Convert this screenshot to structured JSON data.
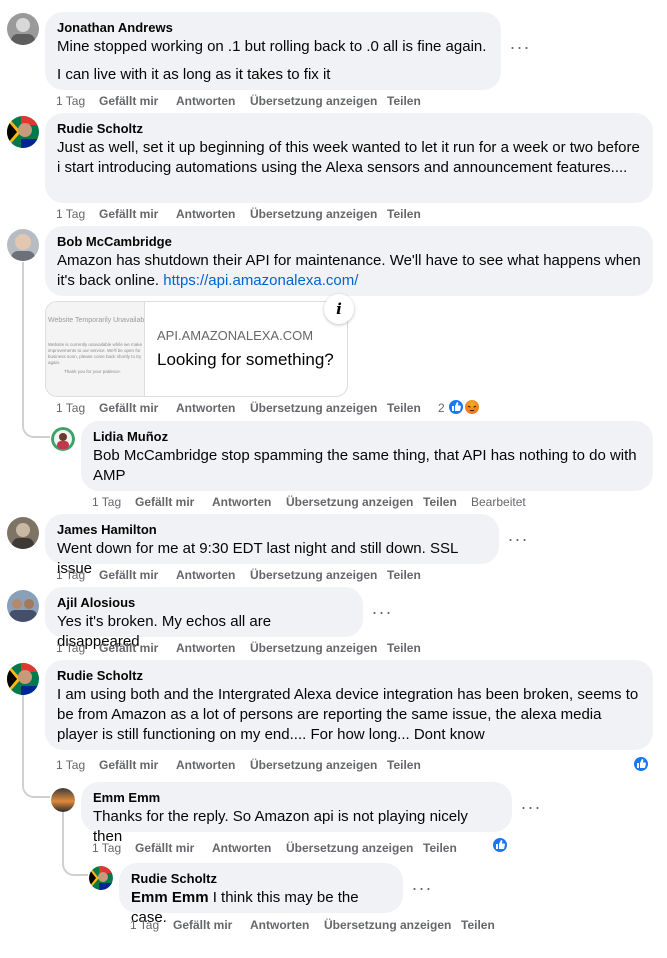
{
  "action_labels": {
    "like": "Gefällt mir",
    "reply": "Antworten",
    "translate": "Übersetzung anzeigen",
    "share": "Teilen",
    "edited": "Bearbeitet"
  },
  "colors": {
    "bubble": "#f0f2f5",
    "secondary_text": "#65676b",
    "link": "#0064d1",
    "like_blue": "#1877f2"
  },
  "comments": [
    {
      "author": "Jonathan Andrews",
      "lines": [
        "Mine stopped working on .1 but rolling back to .0 all is fine again.",
        "I can live with it as long as it takes to fix it"
      ],
      "time": "1 Tag"
    },
    {
      "author": "Rudie Scholtz",
      "text": "Just as well, set it up beginning of this week wanted to let it run for a week or two before i start introducing automations using the Alexa sensors and announcement features....",
      "time": "1 Tag"
    },
    {
      "author": "Bob McCambridge",
      "text": "Amazon has shutdown their API for maintenance. We'll have to see what happens when it's back online.",
      "link_text": "https://api.amazonalexa.com/",
      "time": "1 Tag",
      "reaction_count": "2",
      "reactions": [
        "like",
        "angry"
      ],
      "link_preview": {
        "domain": "API.AMAZONALEXA.COM",
        "title": "Looking for something?",
        "thumb_heading": "Website Temporarily Unavailable",
        "thumb_body": "Website is currently unavailable while we make improvements to our service. We'll be open for business soon, please come back shortly to try again.",
        "thumb_thanks": "Thank you for your patience.",
        "info_icon": "i"
      }
    },
    {
      "author": "Lidia Muñoz",
      "text": "Bob McCambridge stop spamming the same thing, that API has nothing to do with AMP",
      "time": "1 Tag"
    },
    {
      "author": "James Hamilton",
      "text": "Went down for me at 9:30 EDT last night and still down. SSL issue",
      "time": "1 Tag"
    },
    {
      "author": "Ajil Alosious",
      "text": "Yes it's broken. My echos all are disappeared",
      "time": "1 Tag"
    },
    {
      "author": "Rudie Scholtz",
      "text": "I am using both and the Intergrated Alexa device integration has been broken, seems to be from Amazon as a lot of persons are reporting the same issue, the alexa media player is still functioning on my end.... For how long... Dont know",
      "time": "1 Tag",
      "reactions": [
        "like"
      ]
    },
    {
      "author": "Emm Emm",
      "text": "Thanks for the reply. So Amazon api is not playing nicely then",
      "time": "1 Tag",
      "reactions": [
        "like"
      ]
    },
    {
      "author": "Rudie Scholtz",
      "tag": "Emm Emm",
      "text": "I think this may be the case.",
      "time": "1 Tag"
    }
  ],
  "more_icon": "more-options-icon"
}
